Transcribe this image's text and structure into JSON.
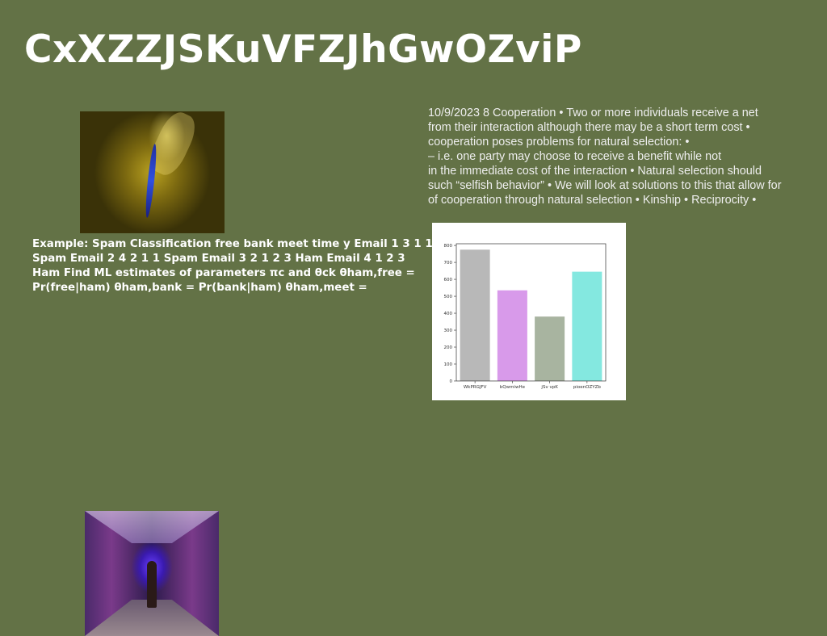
{
  "title": "CxXZZJSKuVFZJhGwOZviP",
  "body_text": "Example: Spam Classification free bank meet time y Email 1 3 1 1 Spam Email 2 4 2 1 1 Spam Email 3 2 1 2 3 Ham Email 4 1 2 3 Ham Find ML estimates of parameters πc and θck θham,free = Pr(free|ham) θham,bank = Pr(bank|ham) θham,meet =",
  "quote_text": "10/9/2023 8 Cooperation • Two or more individuals receive a net\nfrom their interaction although there may be a short term cost •\ncooperation poses problems for natural selection: •\n– i.e. one party may choose to receive a benefit while not\nin the immediate cost of the interaction • Natural selection should\nsuch “selfish behavior” • We will look at solutions to this that allow for\nof cooperation through natural selection • Kinship • Reciprocity •",
  "chart_data": {
    "type": "bar",
    "categories": [
      "WkPRGJFV",
      "bQwmiwHe",
      "jSv vpK",
      "pioenOZYZb"
    ],
    "values": [
      775,
      535,
      380,
      645
    ],
    "colors": [
      "#b8b8b8",
      "#d89aea",
      "#a8b4a0",
      "#84e8e0"
    ],
    "yticks": [
      0,
      100,
      200,
      300,
      400,
      500,
      600,
      700,
      800
    ],
    "ylim": [
      0,
      810
    ]
  }
}
